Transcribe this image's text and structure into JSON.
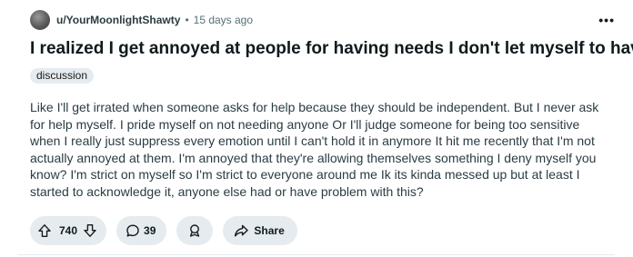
{
  "post": {
    "author": "u/YourMoonlightShawty",
    "separator": "•",
    "time_ago": "15 days ago",
    "more_label": "•••",
    "title": "I realized I get annoyed at people for having needs I don't let myself to have",
    "flair": "discussion",
    "body": "Like I'll get irrated when someone asks for help because they should be independent. But I never ask for help myself. I pride myself on not needing anyone Or I'll judge someone for being too sensitive when I really just suppress every emotion until I can't hold it in anymore It hit me recently that I'm not actually annoyed at them. I'm annoyed that they're allowing themselves something I deny myself you know? I'm strict on myself so I'm strict to everyone around me Ik its kinda messed up but at least I started to acknowledge it, anyone else had or have problem with this?"
  },
  "actions": {
    "vote_count": "740",
    "comment_count": "39",
    "share_label": "Share"
  },
  "icons": {
    "avatar": "avatar",
    "upvote": "upvote-arrow-icon",
    "downvote": "downvote-arrow-icon",
    "comment": "comment-bubble-icon",
    "award": "award-icon",
    "share": "share-arrow-icon",
    "more": "more-dots-icon"
  },
  "colors": {
    "pill_background": "#e5ebee",
    "meta_text": "#576f76",
    "body_text": "#2a3c42",
    "title_text": "#0f1a1c"
  }
}
